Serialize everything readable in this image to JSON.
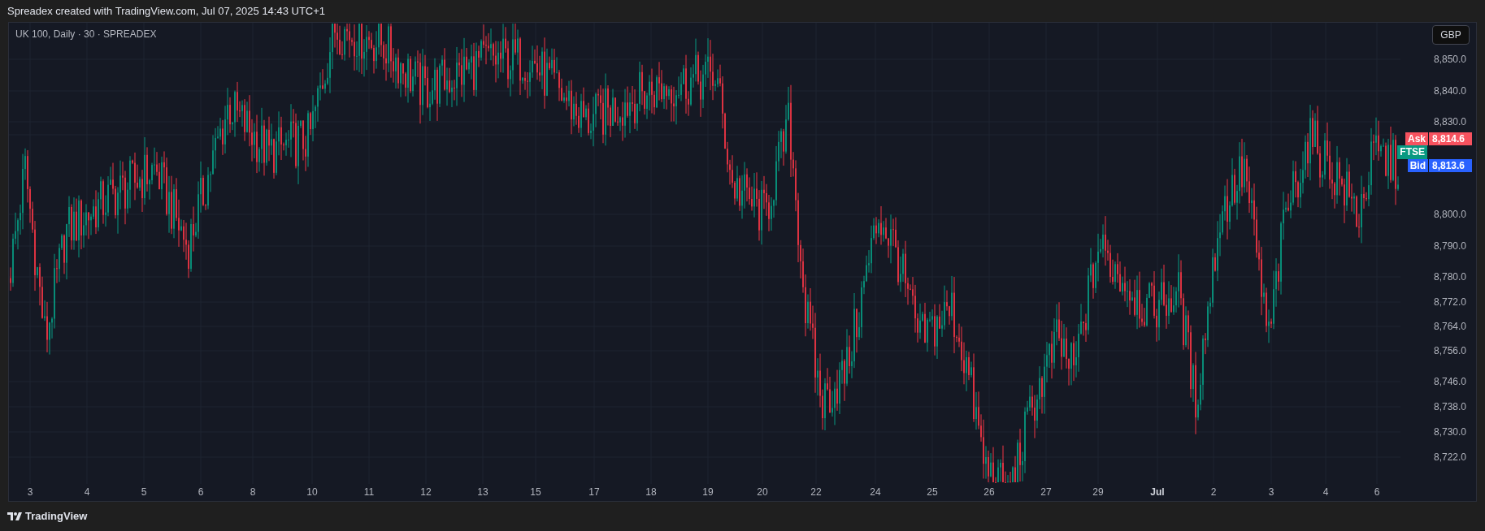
{
  "header": {
    "title": "Spreadex created with TradingView.com, Jul 07, 2025 14:43 UTC+1"
  },
  "chart": {
    "legend": "UK 100, Daily · 30 · SPREADEX",
    "currency_button": "GBP",
    "price_axis": [
      "8,850.0",
      "8,840.0",
      "8,830.0",
      "8,800.0",
      "8,790.0",
      "8,780.0",
      "8,772.0",
      "8,764.0",
      "8,756.0",
      "8,746.0",
      "8,738.0",
      "8,730.0",
      "8,722.0"
    ],
    "time_axis": [
      "3",
      "4",
      "5",
      "6",
      "8",
      "10",
      "11",
      "12",
      "13",
      "15",
      "17",
      "18",
      "19",
      "20",
      "22",
      "24",
      "25",
      "26",
      "27",
      "29",
      "Jul",
      "2",
      "3",
      "4",
      "6"
    ],
    "price_tags": [
      {
        "kind": "ask",
        "label": "Ask",
        "value": "8,814.6",
        "color": "#f7525f"
      },
      {
        "kind": "symbol",
        "label": "FTSE",
        "color": "#089981"
      },
      {
        "kind": "bid",
        "label": "Bid",
        "value": "8,813.6",
        "color": "#2962ff"
      }
    ]
  },
  "footer": {
    "logo_text": "TradingView"
  }
}
